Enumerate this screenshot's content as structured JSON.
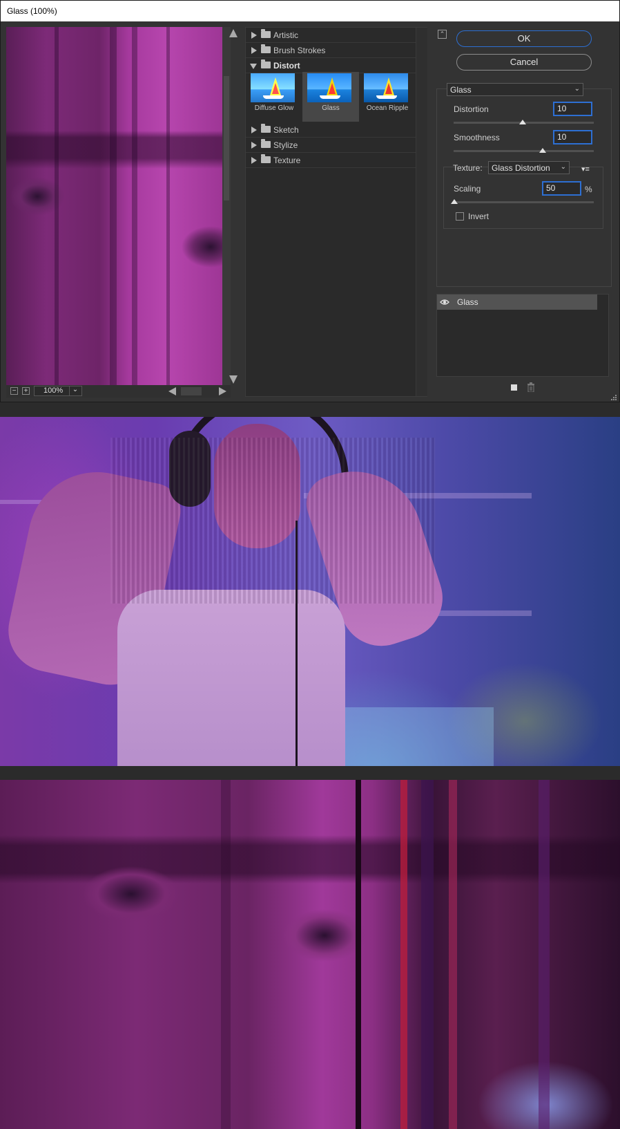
{
  "dialog": {
    "title": "Glass (100%)"
  },
  "preview": {
    "zoom_value": "100%",
    "zoom_out_symbol": "−",
    "zoom_in_symbol": "+"
  },
  "gallery": {
    "categories": [
      {
        "label": "Artistic",
        "expanded": false
      },
      {
        "label": "Brush Strokes",
        "expanded": false
      },
      {
        "label": "Distort",
        "expanded": true
      },
      {
        "label": "Sketch",
        "expanded": false
      },
      {
        "label": "Stylize",
        "expanded": false
      },
      {
        "label": "Texture",
        "expanded": false
      }
    ],
    "distort_filters": [
      {
        "label": "Diffuse Glow",
        "selected": false
      },
      {
        "label": "Glass",
        "selected": true
      },
      {
        "label": "Ocean Ripple",
        "selected": false
      }
    ]
  },
  "buttons": {
    "ok": "OK",
    "cancel": "Cancel"
  },
  "settings": {
    "filter_select": "Glass",
    "distortion": {
      "label": "Distortion",
      "value": "10",
      "level": 10,
      "max": 20
    },
    "smoothness": {
      "label": "Smoothness",
      "value": "10",
      "level": 10,
      "max": 15
    },
    "texture": {
      "label": "Texture:",
      "value": "Glass Distortion"
    },
    "scaling": {
      "label": "Scaling",
      "value": "50",
      "unit": "%",
      "level": 50,
      "min": 50,
      "max": 200
    },
    "invert": {
      "label": "Invert",
      "checked": false
    }
  },
  "layers": [
    {
      "name": "Glass",
      "visible": true
    }
  ],
  "colors": {
    "accent_blue": "#2d6fd3",
    "dialog_bg": "#333333",
    "magenta": "#a5399d"
  },
  "icons": {
    "eye": "eye-icon",
    "new_layer": "new-effect-layer-icon",
    "trash": "trash-icon",
    "collapse": "collapse-icon",
    "menu": "panel-menu-icon"
  }
}
